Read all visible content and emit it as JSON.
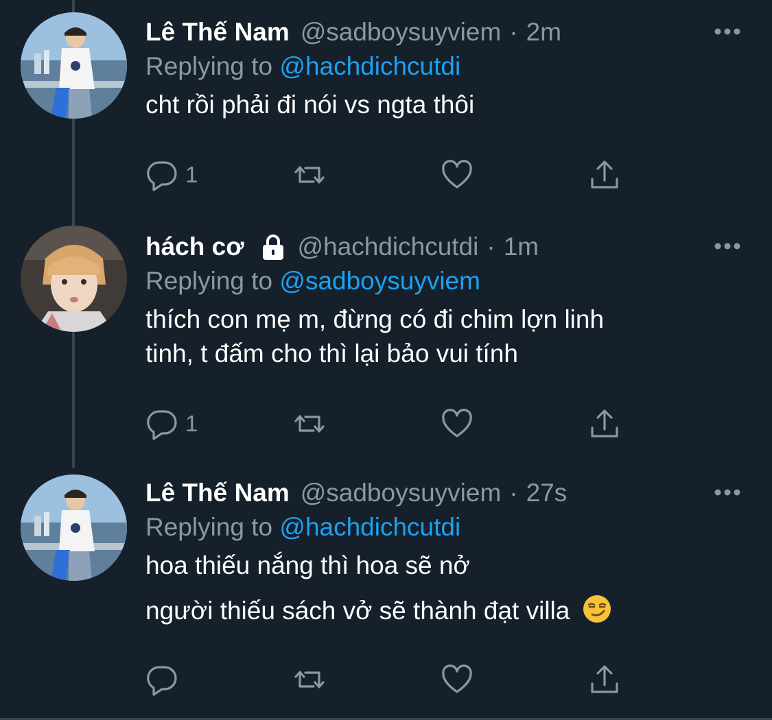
{
  "tweets": [
    {
      "name": "Lê Thế Nam",
      "handle": "@sadboysuyviem",
      "separator": "·",
      "time": "2m",
      "replying_prefix": "Replying to",
      "replying_to": "@hachdichcutdi",
      "lines": [
        "cht rồi phải đi nói vs ngta thôi"
      ],
      "reply_count": "1",
      "locked": false,
      "avatar_icon": "avatar-photo-man-white-shirt"
    },
    {
      "name": "hách cơ",
      "handle": "@hachdichcutdi",
      "separator": "·",
      "time": "1m",
      "replying_prefix": "Replying to",
      "replying_to": "@sadboysuyviem",
      "lines": [
        "thích con mẹ m, đừng có đi chim lợn linh",
        "tinh, t đấm cho thì lại bảo vui tính"
      ],
      "reply_count": "1",
      "locked": true,
      "avatar_icon": "avatar-photo-orange-hair"
    },
    {
      "name": "Lê Thế Nam",
      "handle": "@sadboysuyviem",
      "separator": "·",
      "time": "27s",
      "replying_prefix": "Replying to",
      "replying_to": "@hachdichcutdi",
      "lines": [
        "hoa thiếu nắng thì hoa sẽ nở",
        "người thiếu sách vở sẽ thành đạt villa"
      ],
      "reply_count": "",
      "locked": false,
      "emoji": "smirking-face",
      "avatar_icon": "avatar-photo-man-white-shirt"
    }
  ],
  "icons": {
    "reply": "reply-icon",
    "retweet": "retweet-icon",
    "like": "heart-icon",
    "share": "share-icon",
    "more": "more-icon",
    "lock": "lock-icon"
  },
  "colors": {
    "background": "#15202b",
    "text": "#ffffff",
    "secondary": "#8899a6",
    "link": "#1da1f2",
    "divider": "#38444d"
  }
}
